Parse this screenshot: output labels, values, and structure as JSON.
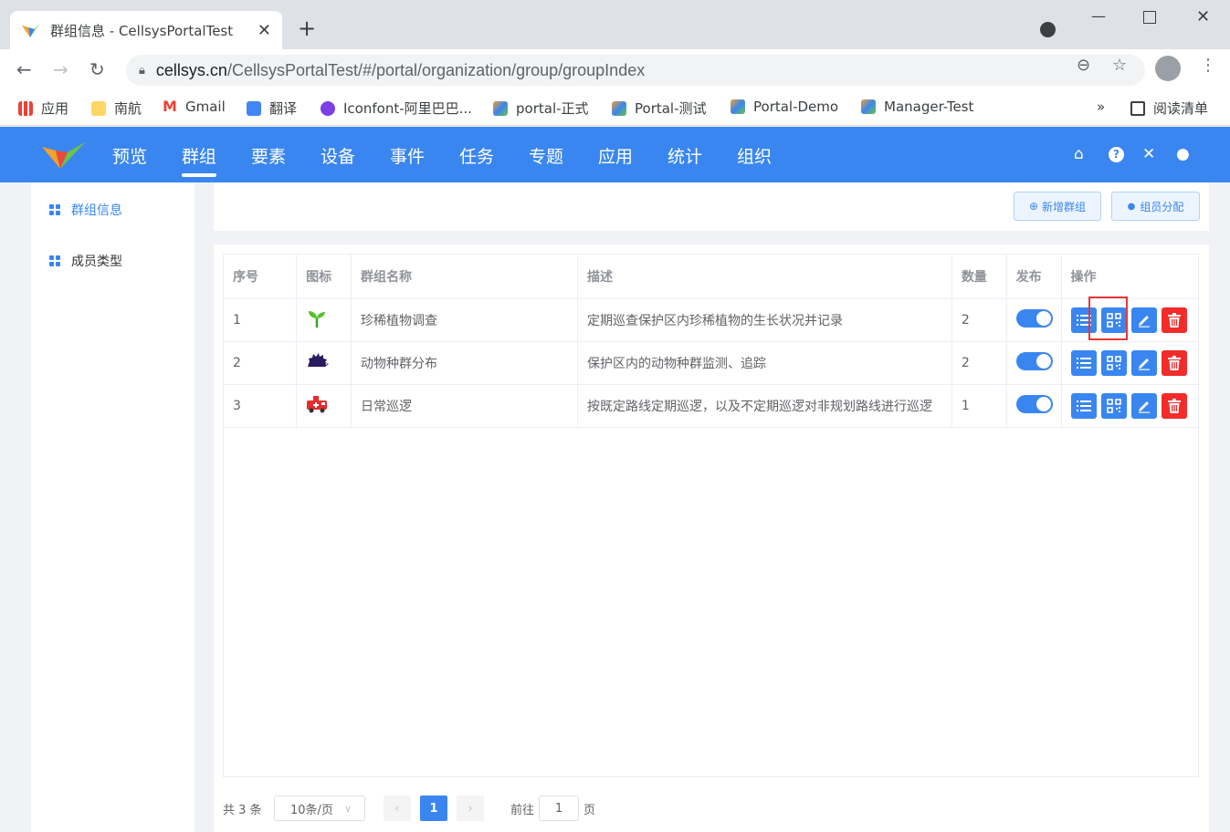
{
  "browser": {
    "tab_title": "群组信息 - CellsysPortalTest",
    "url_domain": "cellsys.cn",
    "url_path": "/CellsysPortalTest/#/portal/organization/group/groupIndex",
    "bookmarks": [
      "应用",
      "南航",
      "Gmail",
      "翻译",
      "Iconfont-阿里巴巴...",
      "portal-正式",
      "Portal-测试",
      "Portal-Demo",
      "Manager-Test"
    ],
    "more": "»",
    "reading_list": "阅读清单"
  },
  "nav": {
    "items": [
      "预览",
      "群组",
      "要素",
      "设备",
      "事件",
      "任务",
      "专题",
      "应用",
      "统计",
      "组织"
    ],
    "active": "群组"
  },
  "sidebar": {
    "items": [
      {
        "label": "群组信息",
        "active": true
      },
      {
        "label": "成员类型",
        "active": false
      }
    ]
  },
  "actions": {
    "add_group": "新增群组",
    "assign_members": "组员分配"
  },
  "table": {
    "headers": [
      "序号",
      "图标",
      "群组名称",
      "描述",
      "数量",
      "发布",
      "操作"
    ],
    "rows": [
      {
        "index": "1",
        "icon": "sprout-icon",
        "name": "珍稀植物调查",
        "desc": "定期巡查保护区内珍稀植物的生长状况并记录",
        "count": "2",
        "published": true
      },
      {
        "index": "2",
        "icon": "hedgehog-icon",
        "name": "动物种群分布",
        "desc": "保护区内的动物种群监测、追踪",
        "count": "2",
        "published": true
      },
      {
        "index": "3",
        "icon": "ambulance-icon",
        "name": "日常巡逻",
        "desc": "按既定路线定期巡逻，以及不定期巡逻对非规划路线进行巡逻",
        "count": "1",
        "published": true
      }
    ]
  },
  "pagination": {
    "total": "共 3 条",
    "page_size": "10条/页",
    "current_page": "1",
    "goto_prefix": "前往",
    "goto_value": "1",
    "goto_suffix": "页"
  },
  "colors": {
    "primary": "#3a86f0",
    "danger": "#f22b2b",
    "highlight": "#e53935"
  }
}
